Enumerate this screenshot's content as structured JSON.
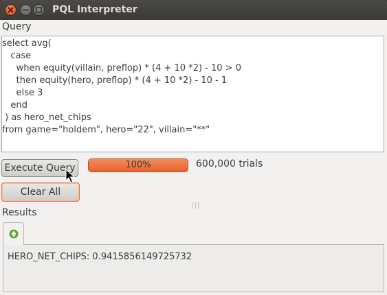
{
  "window": {
    "title": "PQL Interpreter"
  },
  "query": {
    "label": "Query",
    "lines": [
      "select avg(",
      "   case",
      "     when equity(villain, preflop) * (4 + 10 *2) - 10 > 0",
      "     then equity(hero, preflop) * (4 + 10 *2) - 10 - 1",
      "     else 3",
      "   end",
      " ) as hero_net_chips",
      "from game=\"holdem\", hero=\"22\", villain=\"**\""
    ]
  },
  "controls": {
    "execute_label": "Execute Query",
    "clear_label": "Clear All",
    "progress_text": "100%",
    "progress_fraction": 1.0,
    "trials_text": "600,000 trials"
  },
  "results": {
    "label": "Results",
    "tab_icon": "spade-icon",
    "output": "HERO_NET_CHIPS: 0.9415856149725732"
  },
  "colors": {
    "accent": "#e8622d",
    "titlebar": "#3c3b37"
  }
}
